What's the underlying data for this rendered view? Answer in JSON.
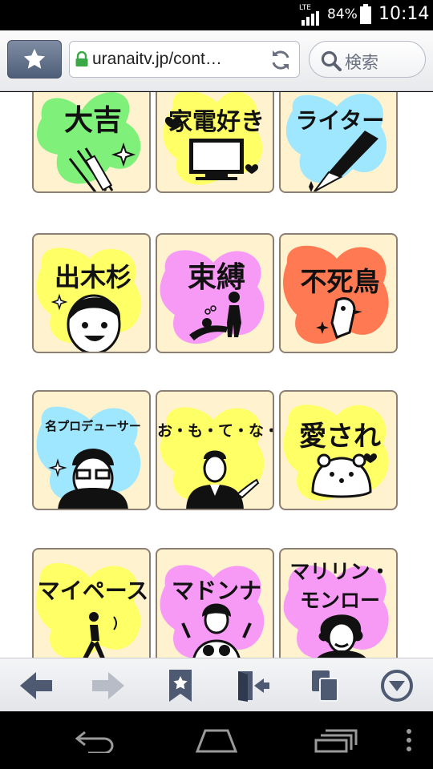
{
  "status_bar": {
    "network": "LTE",
    "battery": "84%",
    "time": "10:14"
  },
  "browser": {
    "url": "uranaitv.jp/cont…",
    "search_placeholder": "検索"
  },
  "cards": [
    {
      "title": "大吉",
      "blob_color": "#7ff07a"
    },
    {
      "title": "家電好き",
      "blob_color": "#ffff66"
    },
    {
      "title": "ライター",
      "blob_color": "#9fe6ff"
    },
    {
      "title": "出木杉",
      "blob_color": "#ffff66"
    },
    {
      "title": "束縛",
      "blob_color": "#f79af5"
    },
    {
      "title": "不死鳥",
      "blob_color": "#ff7a52"
    },
    {
      "title": "名プロデューサー",
      "blob_color": "#9fe6ff"
    },
    {
      "title": "お・も・て・な・し",
      "blob_color": "#ffff66"
    },
    {
      "title": "愛され",
      "blob_color": "#ffff66"
    },
    {
      "title": "マイペース",
      "blob_color": "#ffff66"
    },
    {
      "title": "マドンナ",
      "blob_color": "#f79af5"
    },
    {
      "title": "マリリン・",
      "title2": "モンロー",
      "blob_color": "#f79af5"
    }
  ],
  "bottom_nav": {
    "icons": [
      "back-arrow-icon",
      "forward-arrow-icon",
      "bookmark-icon",
      "exit-door-icon",
      "tabs-icon",
      "menu-dropdown-icon"
    ]
  },
  "android_nav": {
    "icons": [
      "back-icon",
      "home-icon",
      "recent-apps-icon",
      "overflow-menu-icon"
    ]
  }
}
